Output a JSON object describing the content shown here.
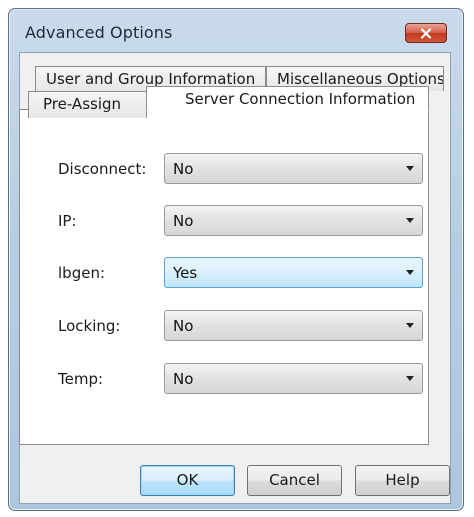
{
  "window": {
    "title": "Advanced Options"
  },
  "tabs": {
    "back_row": [
      {
        "label": "User and Group Information"
      },
      {
        "label": "Miscellaneous Options"
      }
    ],
    "front_row": [
      {
        "label": "Pre-Assign",
        "selected": false
      },
      {
        "label": "Server Connection Information",
        "selected": true
      }
    ]
  },
  "settings": [
    {
      "label": "Disconnect:",
      "value": "No"
    },
    {
      "label": "IP:",
      "value": "No"
    },
    {
      "label": "lbgen:",
      "value": "Yes",
      "highlighted": true
    },
    {
      "label": "Locking:",
      "value": "No"
    },
    {
      "label": "Temp:",
      "value": "No"
    }
  ],
  "buttons": {
    "ok_label": "OK",
    "cancel_label": "Cancel",
    "help_label": "Help"
  },
  "colors": {
    "title_bar": "#b7cde2",
    "close_button": "#c0391f",
    "highlight": "#bee6fd"
  },
  "icons": {
    "close": "close-icon",
    "dropdown": "chevron-down-icon"
  }
}
